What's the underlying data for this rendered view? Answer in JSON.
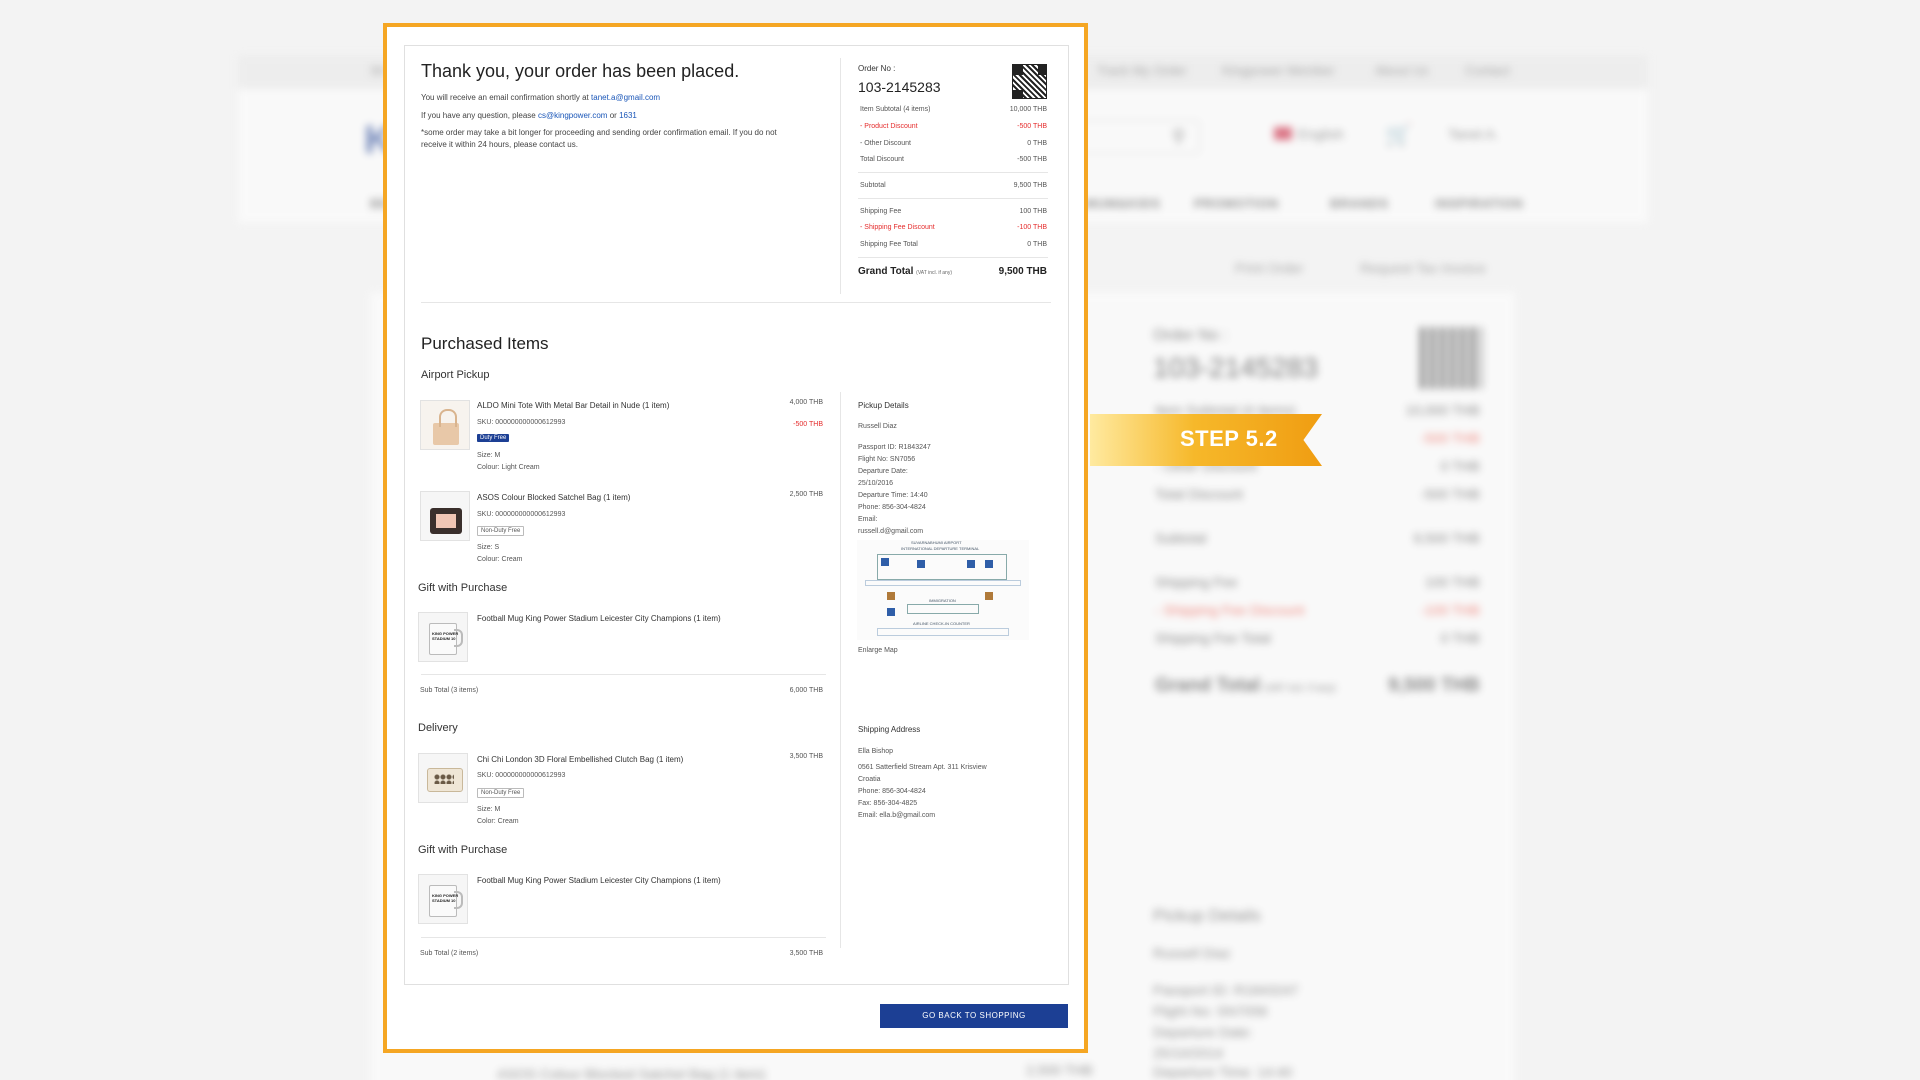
{
  "background": {
    "top_links": [
      "Sh",
      "Track My Order",
      "Kingpower Member",
      "About Us",
      "Contact"
    ],
    "logo": "K",
    "language": "English",
    "user": "Tanet A.",
    "nav": [
      "BE",
      "MUM&KIDS",
      "PROMOTION",
      "BRANDS",
      "INSPIRATION"
    ],
    "print_order": "Print Order",
    "request_tax_invoice": "Request Tax Invoice",
    "order_label": "Order No :",
    "order_number": "103-2145283",
    "rows": [
      {
        "label": "Item Subtotal (4 items)",
        "value": "10,000 THB",
        "red": false
      },
      {
        "label": "",
        "value": "-500 THB",
        "red": true
      },
      {
        "label": "- Other Discount",
        "value": "0 THB",
        "red": false
      },
      {
        "label": "Total Discount",
        "value": "-500 THB",
        "red": false
      },
      {
        "label": "Subtotal",
        "value": "9,500 THB",
        "red": false
      },
      {
        "label": "Shipping Fee",
        "value": "100 THB",
        "red": false
      },
      {
        "label": "- Shipping Fee Discount",
        "value": "-100 THB",
        "red": true
      },
      {
        "label": "Shipping Fee Total",
        "value": "0 THB",
        "red": false
      }
    ],
    "grand_total_label": "Grand Total",
    "grand_total_note": "(VAT incl. if any)",
    "grand_total_value": "9,500 THB",
    "pickup_title": "Pickup Details",
    "pickup_name": "Russell Diaz",
    "pickup_lines": [
      "Passport ID: R1843247",
      "Flight No: SN7056",
      "Departure Date:",
      "25/10/2014",
      "Departure Time: 14:40"
    ],
    "bottom_item": "ASOS Colour Blocked Satchel Bag (1 item)",
    "bottom_item_price": "2,500 THB"
  },
  "step_label": "STEP 5.2",
  "confirmation": {
    "title": "Thank you, your order has been placed.",
    "email_note": "You will receive an email confirmation shortly at",
    "email": "tanet.a@gmail.com",
    "question_note": "If you have any question, please",
    "cs_email": "cs@kingpower.com",
    "or": "or",
    "phone": "1631",
    "delay_note_1": "*some order may take  a bit longer for proceeding and sending order confirmation email. If you do not",
    "delay_note_2": "receive it within 24 hours, please contact us."
  },
  "summary": {
    "order_label": "Order No :",
    "order_number": "103-2145283",
    "item_subtotal_label": "Item Subtotal (4 items)",
    "item_subtotal_value": "10,000 THB",
    "product_discount_label": "- Product Discount",
    "product_discount_value": "-500 THB",
    "other_discount_label": "- Other Discount",
    "other_discount_value": "0 THB",
    "total_discount_label": "Total Discount",
    "total_discount_value": "-500 THB",
    "subtotal_label": "Subtotal",
    "subtotal_value": "9,500 THB",
    "shipping_fee_label": "Shipping Fee",
    "shipping_fee_value": "100 THB",
    "shipping_discount_label": "- Shipping Fee Discount",
    "shipping_discount_value": "-100 THB",
    "shipping_total_label": "Shipping Fee Total",
    "shipping_total_value": "0 THB",
    "grand_total_label": "Grand Total",
    "grand_total_note": "(VAT incl. if any)",
    "grand_total_value": "9,500 THB"
  },
  "purchased": {
    "title": "Purchased Items",
    "airport": {
      "title": "Airport Pickup",
      "item1": {
        "name": "ALDO Mini Tote With Metal Bar Detail in Nude (1 item)",
        "sku": "SKU: 000000000000612993",
        "badge": "Duty Free",
        "size": "Size: M",
        "colour": "Colour: Light Cream",
        "price": "4,000 THB",
        "discount": "-500 THB"
      },
      "item2": {
        "name": "ASOS Colour Blocked Satchel Bag (1 item)",
        "sku": "SKU: 000000000000612993",
        "badge": "Non-Duty Free",
        "size": "Size: S",
        "colour": "Colour: Cream",
        "price": "2,500 THB"
      },
      "gift_title": "Gift with Purchase",
      "gift": {
        "name": "Football Mug King Power Stadium Leicester City Champions (1 item)",
        "mug_text": "KING POWER STADIUM 10"
      },
      "subtotal_label": "Sub Total (3 items)",
      "subtotal_value": "6,000 THB",
      "pickup": {
        "title": "Pickup Details",
        "name": "Russell Diaz",
        "passport": "Passport ID: R1843247",
        "flight": "Flight No: SN7056",
        "dep_date_label": "Departure Date:",
        "dep_date": "25/10/2016",
        "dep_time": "Departure Time: 14:40",
        "phone": "Phone: 856-304-4824",
        "email_label": "Email:",
        "email": "russell.d@gmail.com",
        "map_title": "SUVARNABHUMI AIRPORT",
        "map_subtitle": "INTERNATIONAL DEPARTURE TERMINAL",
        "map_immigration": "IMMIGRATION",
        "map_checkin": "AIRLINE CHECK-IN COUNTER",
        "enlarge": "Enlarge Map"
      }
    },
    "delivery": {
      "title": "Delivery",
      "item1": {
        "name": "Chi Chi London 3D Floral Embellished Clutch Bag (1 item)",
        "sku": "SKU: 000000000000612993",
        "badge": "Non-Duty Free",
        "size": "Size: M",
        "colour": "Color: Cream",
        "price": "3,500 THB"
      },
      "gift_title": "Gift with Purchase",
      "gift": {
        "name": "Football Mug King Power Stadium Leicester City Champions (1 item)",
        "mug_text": "KING POWER STADIUM 10"
      },
      "subtotal_label": "Sub Total (2 items)",
      "subtotal_value": "3,500 THB",
      "shipping": {
        "title": "Shipping Address",
        "name": "Ella Bishop",
        "address": "0561 Satterfield Stream Apt. 311 Krisview",
        "country": "Croatia",
        "phone": "Phone: 856-304-4824",
        "fax": "Fax: 856-304-4825",
        "email": "Email: ella.b@gmail.com"
      }
    }
  },
  "back_button": "GO BACK TO SHOPPING"
}
